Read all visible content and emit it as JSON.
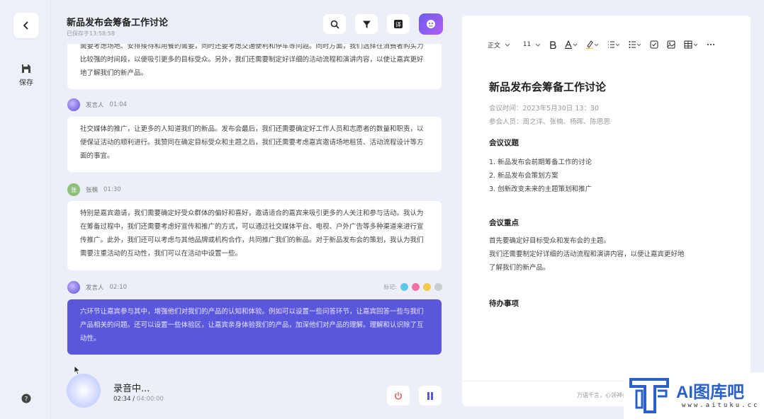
{
  "sidebar": {
    "back_icon": "chevron-left-icon",
    "save_label": "保存",
    "help_icon": "help-icon"
  },
  "header": {
    "title": "新品发布会筹备工作讨论",
    "saved_status": "已保存于13:58:58",
    "buttons": [
      "search-icon",
      "filter-icon",
      "translate-icon",
      "ai-assistant-icon"
    ]
  },
  "transcript": {
    "marks_label": "标记:",
    "entries": [
      {
        "speaker": "",
        "time": "",
        "text": "需要考虑场地、安排接待和用餐的需要，同时还要考虑交通便利和停车等问题。同时方面，我们选择往消费者购买力比较强的时间段，以便吸引更多的目标受众。另外，我们还需要制定好详细的活动流程和演讲内容，以使让嘉宾更好地了解我们的新产品。"
      },
      {
        "speaker": "发言人",
        "time": "01:04",
        "text": "社交媒体的推广，让更多的人知道我们的新品。发布会最后，我们还需要确定好工作人员和志愿者的数量和职责，以便保证活动的顺利进行。我赞同在确定目标受众和主题之后，我们还需要考虑嘉宾邀请场地租赁、活动流程设计等方面的事宜。"
      },
      {
        "speaker": "张楠",
        "time": "01:30",
        "avatar_text": "张",
        "text": "特别是嘉宾邀请，我们需要确定好受众群体的偏好和喜好，邀请适合的嘉宾来吸引更多的人关注和参与活动。我认为在筹备过程中，我们还需要考虑好宣传和推广的方式，可以通过社交媒体平台、电视、户外广告等多种渠道来进行宣传推广。此外，我们还可以考虑与其他品牌或机构合作，共同推广我们的新品。对于新品发布会的策划，我认为我们需要注重活动的互动性，我们可以在活动中设置一些。"
      },
      {
        "speaker": "发言人",
        "time": "02:10",
        "text": "六环节让嘉宾参与其中，增强他们对我们的产品的认知和体验。例如可以设置一些问答环节，让嘉宾回答一些与我们产品相关的问题。还可以设置一些体验区，让嘉宾亲身体验我们的产品，加深他们对产品的理解。理解和认识除了互动性。"
      }
    ],
    "mark_colors": [
      "#5ec8e8",
      "#f06fa8",
      "#f2c94c",
      "#cccccc"
    ]
  },
  "recorder": {
    "status": "录音中...",
    "elapsed": "02:34",
    "total": "04:00:00",
    "stop_icon": "power-icon",
    "pause_icon": "pause-icon"
  },
  "document": {
    "toolbar": {
      "style": "正文",
      "size": "11",
      "icons": [
        "bold-icon",
        "font-color-icon",
        "highlight-icon",
        "ordered-list-icon",
        "bullet-list-icon",
        "checkbox-icon",
        "image-icon",
        "table-icon",
        "more-icon"
      ]
    },
    "title": "新品发布会筹备工作讨论",
    "meeting_time": "会议时间：2023年5月30日 13：30",
    "attendees": "参会人员：周之洋、张楠、杨晖、陈思思",
    "agenda_heading": "会议议题",
    "agenda_items": [
      "1. 新品发布会前期筹备工作的讨论",
      "2. 新品发布会策划方案",
      "3. 创新改变未来的主题策划和推广"
    ],
    "key_points_heading": "会议重点",
    "key_points": [
      "首先要确定好目标受众和发布会的主题。",
      "我们还需要制定好详细的活动流程和演讲内容，以便让嘉宾更好地",
      "了解我们的新产品。"
    ],
    "todo_heading": "待办事项",
    "footer": "万语千言，心领神会"
  },
  "watermark": {
    "brand": "AI图库吧",
    "url": "www.aituku.cc"
  }
}
